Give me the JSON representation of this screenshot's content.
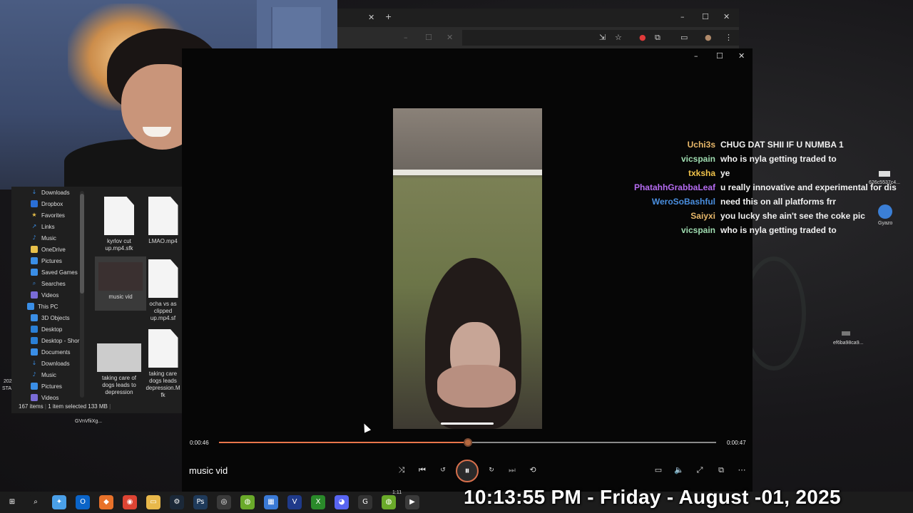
{
  "explorer": {
    "nav_items": [
      {
        "label": "Downloads",
        "icon": "download-icon"
      },
      {
        "label": "Dropbox",
        "icon": "dropbox-icon"
      },
      {
        "label": "Favorites",
        "icon": "star-icon"
      },
      {
        "label": "Links",
        "icon": "link-icon"
      },
      {
        "label": "Music",
        "icon": "music-icon"
      },
      {
        "label": "OneDrive",
        "icon": "folder-icon"
      },
      {
        "label": "Pictures",
        "icon": "pictures-icon"
      },
      {
        "label": "Saved Games",
        "icon": "games-icon"
      },
      {
        "label": "Searches",
        "icon": "search-icon"
      },
      {
        "label": "Videos",
        "icon": "video-icon"
      },
      {
        "label": "This PC",
        "icon": "pc-icon"
      },
      {
        "label": "3D Objects",
        "icon": "cube-icon"
      },
      {
        "label": "Desktop",
        "icon": "desktop-icon"
      },
      {
        "label": "Desktop - Shor",
        "icon": "desktop-icon"
      },
      {
        "label": "Documents",
        "icon": "documents-icon"
      },
      {
        "label": "Downloads",
        "icon": "download-icon"
      },
      {
        "label": "Music",
        "icon": "music-icon"
      },
      {
        "label": "Pictures",
        "icon": "pictures-icon"
      },
      {
        "label": "Videos",
        "icon": "video-icon"
      }
    ],
    "files": [
      {
        "line1": "kyrlov cut",
        "line2": "up.mp4.sfk",
        "line3": ""
      },
      {
        "line1": "LMAO.mp4",
        "line2": "",
        "line3": ""
      },
      {
        "line1": "music vid",
        "line2": "",
        "line3": ""
      },
      {
        "line1": "ocha vs as",
        "line2": "clipped",
        "line3": "up.mp4.sf"
      },
      {
        "line1": "taking care of",
        "line2": "dogs leads to",
        "line3": "depression"
      },
      {
        "line1": "taking care",
        "line2": "dogs leads",
        "line3": "depression.M"
      },
      {
        "line4": "fk"
      }
    ],
    "status": {
      "items": "167 items",
      "selected": "1 item selected",
      "size": "133 MB"
    }
  },
  "desktop": {
    "left_label_1": "202",
    "left_label_2": "STA",
    "file_label": "GVnVfiiXg...",
    "right_icon_1": "626c5537c4...",
    "right_icon_2": "Gyazo",
    "right_icon_3": "ef6ba98ca9..."
  },
  "player": {
    "current_time": "0:00:46",
    "total_time": "0:00:47",
    "progress": 0.5,
    "title": "music vid",
    "controls": {
      "shuffle": "shuffle-icon",
      "previous": "previous-icon",
      "back10": "rewind-10-icon",
      "play_pause": "pause-icon",
      "forward30": "forward-30-icon",
      "next": "next-icon",
      "repeat": "repeat-off-icon",
      "subtitles": "captions-icon",
      "volume": "volume-icon",
      "fullscreen": "fullscreen-icon",
      "miniplayer": "miniplayer-icon",
      "more": "more-icon"
    }
  },
  "chat": [
    {
      "user": "Uchi3s",
      "color": "#e8b86a",
      "msg": "CHUG DAT SHII IF U NUMBA 1"
    },
    {
      "user": "vicspain",
      "color": "#9fdcb0",
      "msg": "who is nyla getting traded to"
    },
    {
      "user": "txksha",
      "color": "#f0c24a",
      "msg": "ye"
    },
    {
      "user": "PhatahhGrabbaLeaf",
      "color": "#b56bf0",
      "msg": "u really innovative and experimental for dis"
    },
    {
      "user": "WeroSoBashful",
      "color": "#4a8fe0",
      "msg": "need this on all platforms frr"
    },
    {
      "user": "Saiyxi",
      "color": "#e8b86a",
      "msg": "you lucky she ain't see the coke pic"
    },
    {
      "user": "vicspain",
      "color": "#9fdcb0",
      "msg": "who is nyla getting traded to"
    }
  ],
  "overlay_clock": "10:13:55 PM - Friday - August -01, 2025",
  "taskbar": {
    "small_time": "1:11",
    "items": [
      "windows-icon",
      "search-icon",
      "copilot-icon",
      "outlook-icon",
      "brave-icon",
      "chrome-icon",
      "file-explorer-icon",
      "steam-icon",
      "photoshop-icon",
      "app-icon",
      "obs-icon",
      "store-icon",
      "vegas-icon",
      "xbox-icon",
      "discord-icon",
      "epic-icon",
      "app2-icon",
      "media-player-icon"
    ]
  }
}
